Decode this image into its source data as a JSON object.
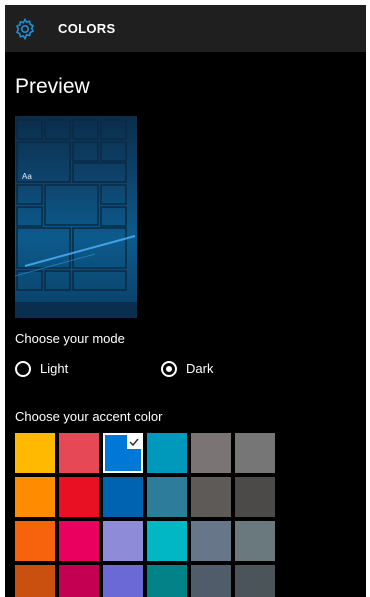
{
  "header": {
    "title": "COLORS",
    "icon": "gear-icon",
    "icon_color": "#1e90d8"
  },
  "preview": {
    "heading": "Preview",
    "tile_text": "Aa"
  },
  "mode": {
    "label": "Choose your mode",
    "options": [
      {
        "label": "Light",
        "checked": false
      },
      {
        "label": "Dark",
        "checked": true
      }
    ]
  },
  "accent": {
    "label": "Choose your accent color",
    "selected_index": 2,
    "colors": [
      "#ffb900",
      "#e74856",
      "#0078d7",
      "#0099bc",
      "#7a7574",
      "#767676",
      "#ff8c00",
      "#e81123",
      "#0063b1",
      "#2d7d9a",
      "#5d5a58",
      "#4c4a48",
      "#f7630c",
      "#ea005e",
      "#8e8cd8",
      "#00b7c3",
      "#68768a",
      "#69797e",
      "#ca5010",
      "#c30052",
      "#6b69d6",
      "#038387",
      "#515c6b",
      "#4a5459"
    ]
  }
}
